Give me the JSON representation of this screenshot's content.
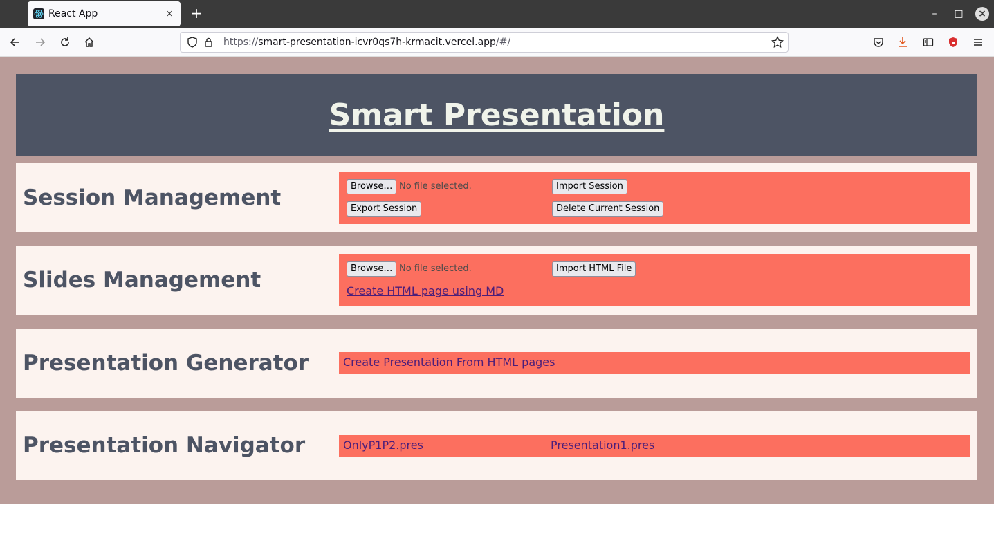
{
  "browser": {
    "tab_title": "React App",
    "tab_close": "×",
    "new_tab": "+",
    "url_scheme": "https://",
    "url_host": "smart-presentation-icvr0qs7h-krmacit.vercel.app",
    "url_path": "/#/",
    "window_controls": [
      "–",
      "□",
      "×"
    ]
  },
  "page": {
    "title": "Smart Presentation",
    "sections": {
      "session": {
        "label": "Session Management",
        "browse_label": "Browse…",
        "no_file": "No file selected.",
        "import_label": "Import Session",
        "export_label": "Export Session",
        "delete_label": "Delete Current Session"
      },
      "slides": {
        "label": "Slides Management",
        "browse_label": "Browse…",
        "no_file": "No file selected.",
        "import_label": "Import HTML File",
        "create_link": "Create HTML page using MD"
      },
      "generator": {
        "label": "Presentation Generator",
        "create_link": "Create Presentation From HTML pages"
      },
      "navigator": {
        "label": "Presentation Navigator",
        "files": [
          "OnlyP1P2.pres",
          "Presentation1.pres"
        ]
      }
    }
  },
  "colors": {
    "page_bg": "#ba9c99",
    "header_bg": "#4d5464",
    "section_bg": "#fcf3ef",
    "panel_bg": "#fc6f5f",
    "label_color": "#4d5464"
  }
}
